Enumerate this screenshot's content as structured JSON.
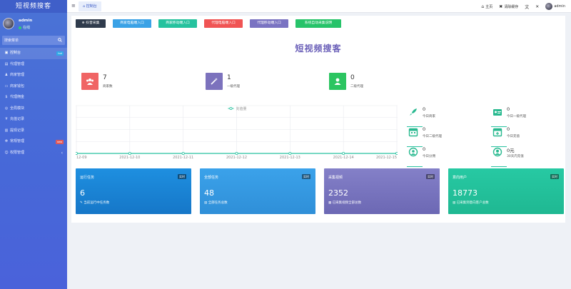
{
  "app": {
    "logo_title": "短视频搜客",
    "user_name": "admin",
    "user_status": "在线"
  },
  "search": {
    "placeholder": "搜索菜单"
  },
  "sidebar": {
    "items": [
      {
        "label": "控制台",
        "icon": "dashboard-icon",
        "badge": "hot",
        "badge_color": "#2fa8e6"
      },
      {
        "label": "代理管理",
        "icon": "agent-icon"
      },
      {
        "label": "商家管理",
        "icon": "merchant-icon"
      },
      {
        "label": "商家钱包",
        "icon": "wallet-icon"
      },
      {
        "label": "代理佣金",
        "icon": "commission-icon"
      },
      {
        "label": "全局模块",
        "icon": "module-icon"
      },
      {
        "label": "充值记录",
        "icon": "yen-icon"
      },
      {
        "label": "提现记录",
        "icon": "withdraw-icon"
      },
      {
        "label": "常规管理",
        "icon": "cog-icon",
        "badge": "new",
        "badge_color": "#e05a5a"
      },
      {
        "label": "权限管理",
        "icon": "group-icon",
        "arrow": "‹"
      }
    ]
  },
  "topbar": {
    "menu_icon": "≡",
    "tab_label": "控制台",
    "nav": [
      {
        "label": "主页",
        "icon": "home-icon"
      },
      {
        "label": "清除缓存",
        "icon": "trash-icon"
      },
      {
        "label": "",
        "icon": "translate-icon"
      },
      {
        "label": "",
        "icon": "fullscreen-icon"
      },
      {
        "label": "admin",
        "icon": "avatar"
      }
    ]
  },
  "quick_buttons": [
    {
      "label": "抖音采集",
      "color": "#2f3b4c"
    },
    {
      "label": "商家电脑端入口",
      "color": "#3aa2e6"
    },
    {
      "label": "商家移动端入口",
      "color": "#25c29e"
    },
    {
      "label": "代理电脑端入口",
      "color": "#f05454"
    },
    {
      "label": "代理移动端入口",
      "color": "#7a73c2"
    },
    {
      "label": "系统自动采集说明",
      "color": "#27c36a"
    }
  ],
  "page_title": "短视频搜客",
  "stats": [
    {
      "value": "7",
      "label": "商家数",
      "color": "#f06464",
      "icon": "users-icon"
    },
    {
      "value": "1",
      "label": "一级代理",
      "color": "#7c72bd",
      "icon": "magic-icon"
    },
    {
      "value": "0",
      "label": "二级代理",
      "color": "#2cc561",
      "icon": "user-icon"
    }
  ],
  "chart_data": {
    "type": "line",
    "title": "",
    "series": [
      {
        "name": "充值量",
        "values": [
          0,
          0,
          0,
          0,
          0,
          0,
          0,
          0
        ]
      }
    ],
    "x": [
      "12-09",
      "2021-12-10",
      "2021-12-11",
      "2021-12-12",
      "2021-12-13",
      "2021-12-14",
      "2021-12-15"
    ],
    "ylim": [
      0,
      1
    ],
    "grid": true,
    "legend": "top-center",
    "color": "#28c2a0"
  },
  "mini_stats": [
    {
      "value": "0",
      "label": "今日商家",
      "icon": "rocket-icon"
    },
    {
      "value": "0",
      "label": "今日一级代理",
      "icon": "id-card-icon"
    },
    {
      "value": "0",
      "label": "今日二级代理",
      "icon": "calendar-icon"
    },
    {
      "value": "0",
      "label": "今日充值",
      "icon": "calendar-plus-icon"
    },
    {
      "value": "0",
      "label": "今日分佣",
      "icon": "circle-icon"
    },
    {
      "value": "0元",
      "label": "30天内充值",
      "icon": "user-circle-icon"
    }
  ],
  "cards": [
    {
      "title": "运行任务",
      "badge": "实时",
      "value": "6",
      "desc": "当前运行中任务数",
      "color1": "#1e8fe0",
      "color2": "#1677c8",
      "icon": "pen-icon"
    },
    {
      "title": "全部任务",
      "badge": "实时",
      "value": "48",
      "desc": "全部任务总数",
      "color1": "#3ba2ea",
      "color2": "#2f8fd8",
      "icon": "file-icon"
    },
    {
      "title": "采集视频",
      "badge": "实时",
      "value": "2352",
      "desc": "已采集视频全部总数",
      "color1": "#8480c8",
      "color2": "#6c68b4",
      "icon": "film-icon"
    },
    {
      "title": "意向用户",
      "badge": "实时",
      "value": "18773",
      "desc": "已采集到意向客户总数",
      "color1": "#27c9a3",
      "color2": "#1fb892",
      "icon": "image-icon"
    }
  ]
}
